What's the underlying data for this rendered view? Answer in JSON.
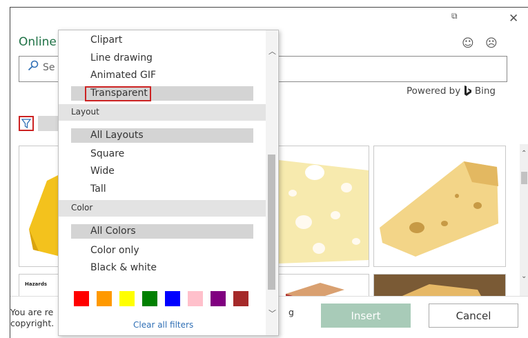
{
  "dialog": {
    "title": "Online",
    "search_placeholder": "Se",
    "powered_by": "Powered by",
    "bing": "Bing",
    "insert_label": "Insert",
    "cancel_label": "Cancel",
    "notice_line1": "You are re",
    "notice_line2": "copyright.",
    "notice_tail": "g"
  },
  "filter_menu": {
    "type_items": [
      "Clipart",
      "Line drawing",
      "Animated GIF",
      "Transparent"
    ],
    "layout_header": "Layout",
    "layout_items": [
      "All Layouts",
      "Square",
      "Wide",
      "Tall"
    ],
    "color_header": "Color",
    "color_items": [
      "All Colors",
      "Color only",
      "Black & white"
    ],
    "swatches": [
      "#ff0000",
      "#ff9900",
      "#ffff00",
      "#008000",
      "#0000ff",
      "#ffc0cb",
      "#800080",
      "#a52a2a"
    ],
    "clear_label": "Clear all filters"
  },
  "thumbnails": {
    "hazards_label": "Hazards"
  },
  "colors": {
    "title_green": "#1e7145",
    "insert_bg": "#a8cbb8",
    "highlight_red": "#cc2222"
  }
}
